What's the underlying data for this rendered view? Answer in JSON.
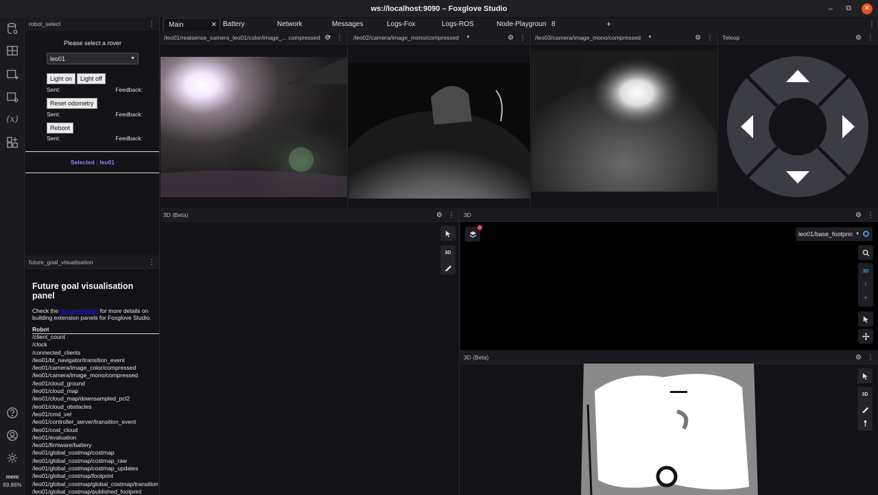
{
  "window": {
    "title": "ws://localhost:9090 – Foxglove Studio",
    "min": "–",
    "restore": "⧉",
    "close": "✕"
  },
  "sidebar": {
    "mem_label": "mem",
    "mem_value": "69.86%"
  },
  "tabs": [
    {
      "label": "Main",
      "close": "✕"
    },
    {
      "label": "Battery"
    },
    {
      "label": "Network"
    },
    {
      "label": "Messages"
    },
    {
      "label": "Logs-Fox"
    },
    {
      "label": "Logs-ROS"
    },
    {
      "label": "Node-Playgroun"
    },
    {
      "label": "8"
    },
    {
      "label": "+"
    }
  ],
  "robot_select": {
    "title": "robot_select",
    "prompt": "Please select a rover",
    "selected": "leo01",
    "light_on": "Light on",
    "light_off": "Light off",
    "sent": "Sent:",
    "feedback": "Feedback:",
    "reset_odometry": "Reset odometry",
    "reboot": "Reboot",
    "selected_status": "Selected : leo01"
  },
  "future_goal": {
    "title": "future_goal_visualisation",
    "heading": "Future goal visualisation panel",
    "desc_pre": "Check the ",
    "desc_link": "documentation",
    "desc_post": " for more details on building extension panels for Foxglove Studio.",
    "list_header": "Robot",
    "topics": [
      "/client_count",
      "/clock",
      "/connected_clients",
      "/leo01/bt_navigator/transition_event",
      "/leo01/camera/image_color/compressed",
      "/leo01/camera/image_mono/compressed",
      "/leo01/cloud_ground",
      "/leo01/cloud_map",
      "/leo01/cloud_map/downsampled_pcl2",
      "/leo01/cloud_obstacles",
      "/leo01/cmd_vel",
      "/leo01/controller_server/transition_event",
      "/leo01/cost_cloud",
      "/leo01/evaluation",
      "/leo01/firmware/battery",
      "/leo01/global_costmap/costmap",
      "/leo01/global_costmap/costmap_raw",
      "/leo01/global_costmap/costmap_updates",
      "/leo01/global_costmap/footprint",
      "/leo01/global_costmap/global_costmap/transition",
      "/leo01/global_costmap/published_footprint"
    ]
  },
  "cameras": [
    {
      "topic": "/leo01/realsense_camera_leo01/color/image_... compressed"
    },
    {
      "topic": "/leo02/camera/image_mono/compressed"
    },
    {
      "topic": "/leo03/camera/image_mono/compressed"
    }
  ],
  "teleop": {
    "title": "Teleop"
  },
  "panel_3d_beta_left": {
    "title": "3D (Beta)"
  },
  "panel_3d": {
    "title": "3D",
    "frame": "leo01/base_footprin",
    "btn_3d": "3D"
  },
  "panel_3d_beta_right": {
    "title": "3D (Beta)",
    "btn_3d": "3D"
  },
  "icons": {
    "settings": "⚙",
    "more": "⋮",
    "caret": "▼"
  }
}
